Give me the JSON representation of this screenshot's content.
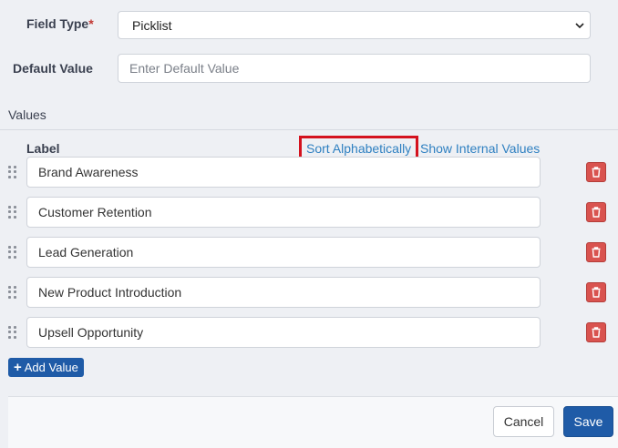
{
  "field_type": {
    "label": "Field Type",
    "required_mark": "*",
    "selected_value": "Picklist"
  },
  "default_value": {
    "label": "Default Value",
    "placeholder": "Enter Default Value",
    "value": ""
  },
  "values_section": {
    "title": "Values",
    "column_label": "Label",
    "sort_link": "Sort Alphabetically",
    "internal_link": "Show Internal Values",
    "items": [
      {
        "label": "Brand Awareness"
      },
      {
        "label": "Customer Retention"
      },
      {
        "label": "Lead Generation"
      },
      {
        "label": "New Product Introduction"
      },
      {
        "label": "Upsell Opportunity"
      }
    ],
    "add_button": "Add Value"
  },
  "footer": {
    "cancel_label": "Cancel",
    "save_label": "Save"
  },
  "colors": {
    "primary": "#1f5ba7",
    "link": "#2f80c1",
    "delete": "#d9534f",
    "highlight": "#d4121e"
  },
  "icons": {
    "drag": "drag-handle-icon",
    "delete": "trash-icon",
    "add": "plus-icon",
    "dropdown": "chevron-down-icon"
  }
}
